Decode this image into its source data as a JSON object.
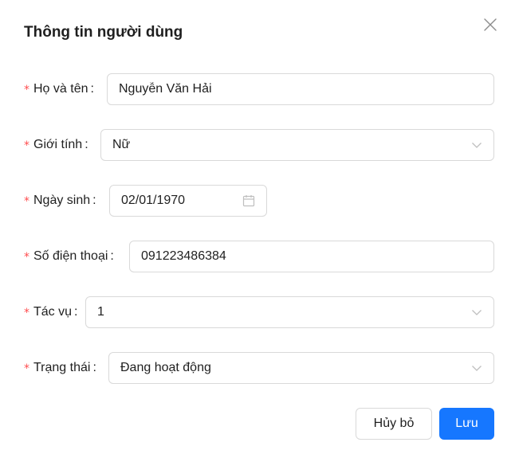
{
  "dialog": {
    "title": "Thông tin người dùng",
    "close_icon": "close-icon"
  },
  "form": {
    "full_name": {
      "required_mark": "*",
      "label": "Họ và tên",
      "colon": ":",
      "value": "Nguyễn Văn Hải"
    },
    "gender": {
      "required_mark": "*",
      "label": "Giới tính",
      "colon": ":",
      "value": "Nữ",
      "icon": "chevron-down-icon"
    },
    "birth_date": {
      "required_mark": "*",
      "label": "Ngày sinh",
      "colon": ":",
      "value": "02/01/1970",
      "icon": "calendar-icon"
    },
    "phone": {
      "required_mark": "*",
      "label": "Số điện thoại",
      "colon": ":",
      "value": "091223486384"
    },
    "task": {
      "required_mark": "*",
      "label": "Tác vụ",
      "colon": ":",
      "value": "1",
      "icon": "chevron-down-icon"
    },
    "status": {
      "required_mark": "*",
      "label": "Trạng thái",
      "colon": ":",
      "value": "Đang hoạt động",
      "icon": "chevron-down-icon"
    }
  },
  "footer": {
    "cancel_label": "Hủy bỏ",
    "save_label": "Lưu"
  },
  "colors": {
    "primary": "#1677ff",
    "required": "#ff4d4f",
    "border": "#d9d9d9"
  }
}
